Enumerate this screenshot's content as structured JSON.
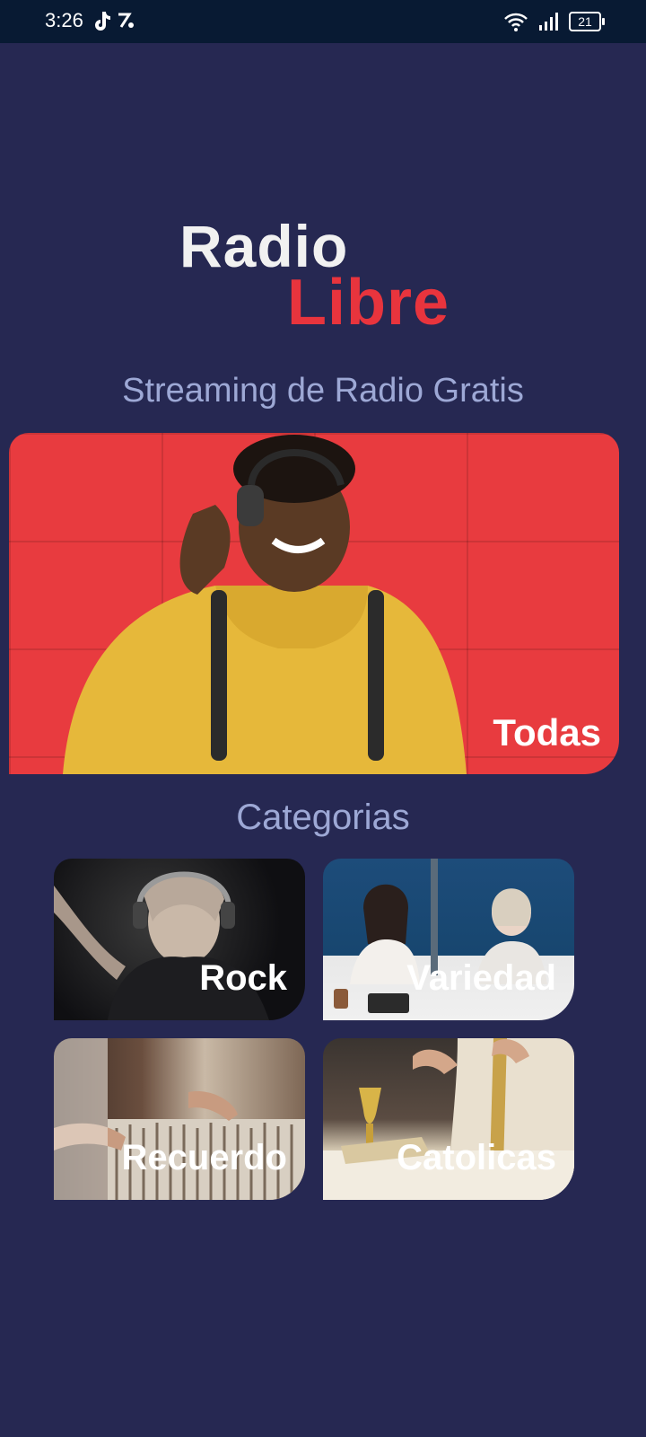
{
  "status_bar": {
    "time": "3:26",
    "battery": "21"
  },
  "logo": {
    "line1": "Radio",
    "line2": "Libre"
  },
  "subtitle": "Streaming de Radio Gratis",
  "hero": {
    "label": "Todas"
  },
  "section_title": "Categorias",
  "categories": [
    {
      "label": "Rock"
    },
    {
      "label": "Variedad"
    },
    {
      "label": "Recuerdo"
    },
    {
      "label": "Catolicas"
    }
  ],
  "colors": {
    "background": "#262852",
    "status_bar": "#081a33",
    "accent_red": "#e8343d",
    "muted_text": "#9da8d5"
  }
}
